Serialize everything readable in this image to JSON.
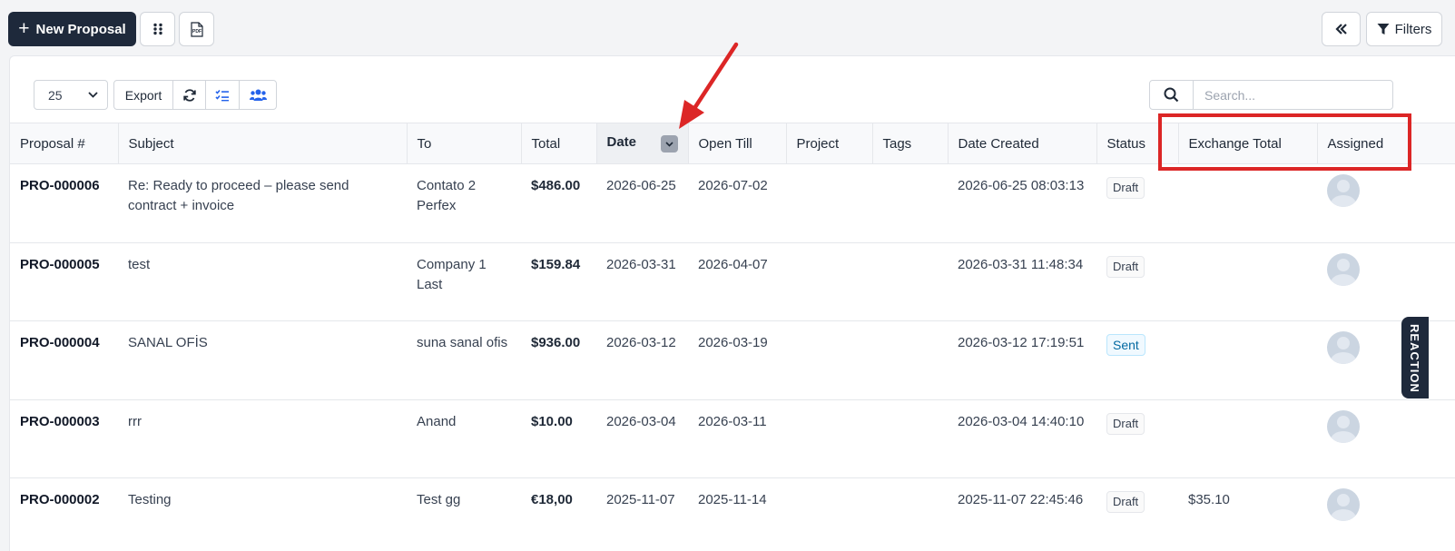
{
  "toolbar": {
    "new_proposal_label": "New Proposal",
    "pdf_label": "PDF",
    "filters_label": "Filters"
  },
  "table_controls": {
    "page_size": "25",
    "export_label": "Export",
    "search_placeholder": "Search..."
  },
  "table": {
    "columns": [
      "Proposal #",
      "Subject",
      "To",
      "Total",
      "Date",
      "Open Till",
      "Project",
      "Tags",
      "Date Created",
      "Status",
      "Exchange Total",
      "Assigned"
    ],
    "sorted_column": "Date",
    "rows": [
      {
        "number": "PRO-000006",
        "subject": "Re: Ready to proceed – please send contract + invoice",
        "to": "Contato 2 Perfex",
        "total": "$486.00",
        "date": "2026-06-25",
        "open_till": "2026-07-02",
        "project": "",
        "tags": "",
        "date_created": "2026-06-25 08:03:13",
        "status": "Draft",
        "exchange_total": ""
      },
      {
        "number": "PRO-000005",
        "subject": "test",
        "to": "Company 1 Last",
        "total": "$159.84",
        "date": "2026-03-31",
        "open_till": "2026-04-07",
        "project": "",
        "tags": "",
        "date_created": "2026-03-31 11:48:34",
        "status": "Draft",
        "exchange_total": ""
      },
      {
        "number": "PRO-000004",
        "subject": "SANAL OFİS",
        "to": "suna sanal ofis",
        "total": "$936.00",
        "date": "2026-03-12",
        "open_till": "2026-03-19",
        "project": "",
        "tags": "",
        "date_created": "2026-03-12 17:19:51",
        "status": "Sent",
        "exchange_total": ""
      },
      {
        "number": "PRO-000003",
        "subject": "rrr",
        "to": "Anand",
        "total": "$10.00",
        "date": "2026-03-04",
        "open_till": "2026-03-11",
        "project": "",
        "tags": "",
        "date_created": "2026-03-04 14:40:10",
        "status": "Draft",
        "exchange_total": ""
      },
      {
        "number": "PRO-000002",
        "subject": "Testing",
        "to": "Test gg",
        "total": "€18,00",
        "date": "2025-11-07",
        "open_till": "2025-11-14",
        "project": "",
        "tags": "",
        "date_created": "2025-11-07 22:45:46",
        "status": "Draft",
        "exchange_total": "$35.10"
      }
    ]
  },
  "side_tab_label": "REACTION",
  "colors": {
    "primary": "#1e293b",
    "accent_blue": "#2563eb",
    "annotation_red": "#dc2626",
    "sent_badge": "#0369a1"
  }
}
